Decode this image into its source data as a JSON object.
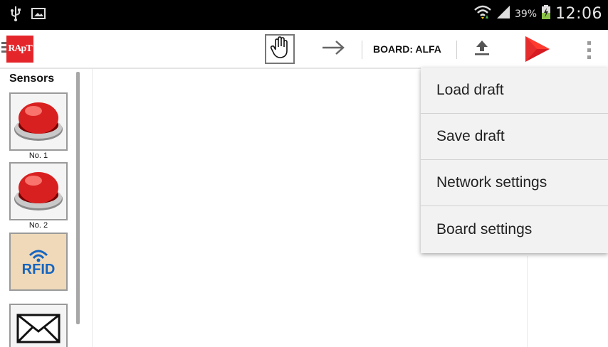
{
  "status_bar": {
    "icons_left": [
      "usb-icon",
      "gallery-icon"
    ],
    "icons_right": [
      "wifi-icon",
      "signal-icon",
      "battery-charging-icon"
    ],
    "battery": "39%",
    "time": "12:06"
  },
  "action_bar": {
    "logo_text": "RApT",
    "board_label": "BOARD: ALFA",
    "icons": [
      "hand-icon",
      "arrow-right-icon",
      "upload-icon",
      "play-store-icon",
      "overflow-menu-icon"
    ],
    "colors": {
      "logo": "#e4262b",
      "play_store_top": "#ff3b30",
      "play_store_bottom": "#d81b22"
    }
  },
  "sidebar": {
    "title": "Sensors",
    "items": [
      {
        "icon": "red-button-icon",
        "caption": "No. 1"
      },
      {
        "icon": "red-button-icon",
        "caption": "No. 2"
      },
      {
        "icon": "rfid-icon",
        "caption": "",
        "rfid_text": "RFID"
      },
      {
        "icon": "envelope-icon",
        "caption": ""
      }
    ]
  },
  "menu": {
    "items": [
      "Load draft",
      "Save draft",
      "Network settings",
      "Board settings"
    ]
  }
}
